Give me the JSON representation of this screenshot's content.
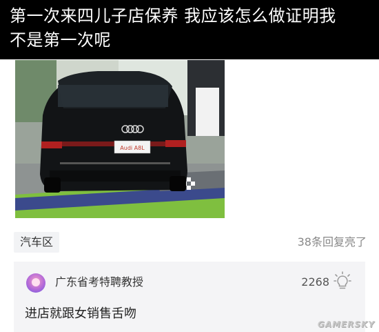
{
  "post": {
    "title": "第一次来四儿子店保养 我应该怎么做证明我\n不是第一次呢",
    "image_description_icon": "car-photo",
    "car_badge_text": "Audi A8L"
  },
  "meta": {
    "category": "汽车区",
    "reply_count_text": "38条回复亮了"
  },
  "top_comment": {
    "username": "广东省考特聘教授",
    "likes": "2268",
    "text": "进店就跟女销售舌吻"
  },
  "watermark": "GAMERSKY",
  "colors": {
    "title_bg": "#000000",
    "title_text": "#ffffff",
    "comment_bg": "#f4f4f6",
    "tag_bg": "#f2f3f5",
    "meta_text": "#888888"
  }
}
